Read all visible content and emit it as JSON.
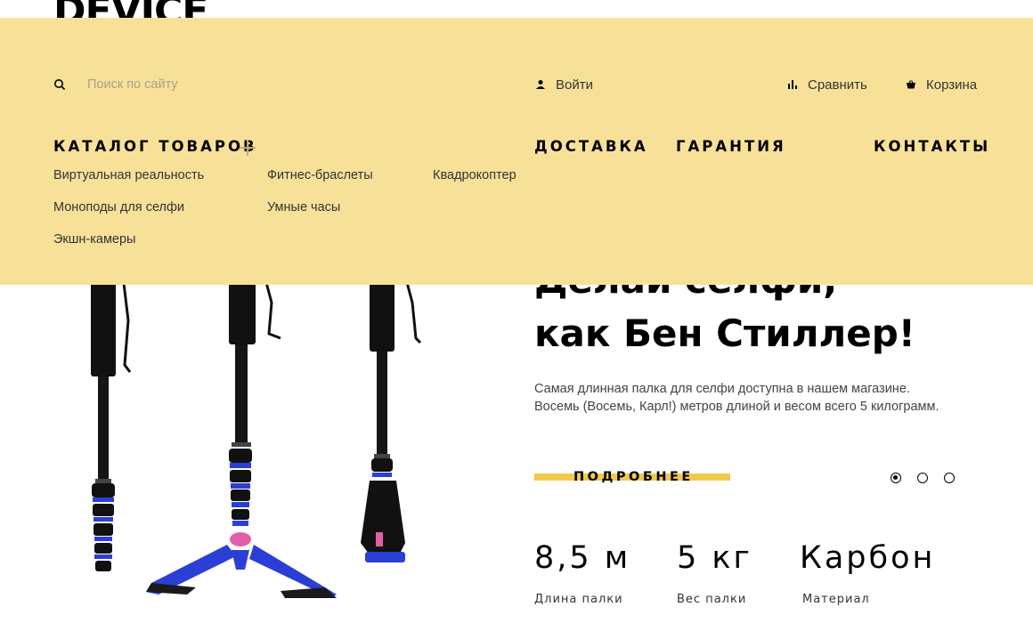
{
  "brand": {
    "logo_text": "DEVICE"
  },
  "header": {
    "search_placeholder": "Поиск по сайту",
    "login_label": "Войти",
    "compare_label": "Сравнить",
    "cart_label": "Корзина"
  },
  "nav": {
    "catalog_label": "КАТАЛОГ ТОВАРОВ",
    "delivery_label": "ДОСТАВКА",
    "warranty_label": "ГАРАНТИЯ",
    "contacts_label": "КОНТАКТЫ"
  },
  "catalog": {
    "items": [
      "Виртуальная реальность",
      "Моноподы для селфи",
      "Экшн-камеры",
      "Фитнес-браслеты",
      "Умные часы",
      "Квадрокоптер"
    ]
  },
  "hero": {
    "title_line1": "Делай селфи,",
    "title_line2": "как Бен Стиллер!",
    "desc_line1": "Самая длинная палка для селфи доступна в нашем магазине.",
    "desc_line2": "Восемь (Восемь, Карл!) метров длиной и весом всего 5 килограмм.",
    "more_label": "ПОДРОБНЕЕ",
    "slides_total": 3,
    "active_slide": 1
  },
  "stats": [
    {
      "value": "8,5 м",
      "label": "Длина палки"
    },
    {
      "value": "5 кг",
      "label": "Вес палки"
    },
    {
      "value": "Карбон",
      "label": "Материал"
    }
  ],
  "colors": {
    "panel_bg": "#f7e199",
    "accent": "#f2c94c",
    "monopod_blue": "#2b3fd6",
    "monopod_pink": "#e05fa8"
  }
}
